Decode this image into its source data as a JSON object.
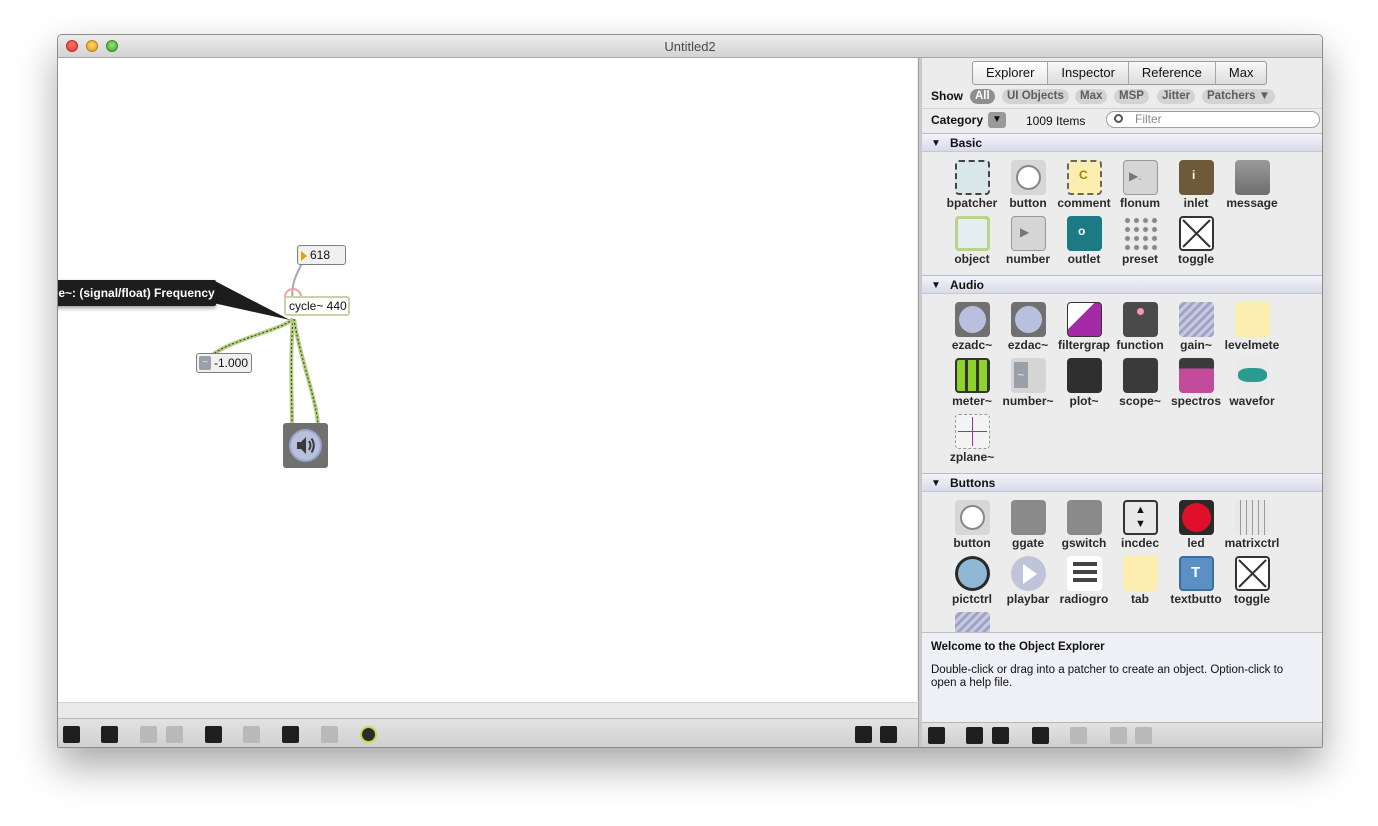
{
  "window": {
    "title": "Untitled2"
  },
  "patcher": {
    "tooltip": "cycle~: (signal/float) Frequency",
    "number_box": "618",
    "cycle_object": "cycle~ 440",
    "signal_number": "-1.000"
  },
  "explorer": {
    "tabs": [
      "Explorer",
      "Inspector",
      "Reference",
      "Max"
    ],
    "show_label": "Show",
    "filters": [
      "All",
      "UI Objects",
      "Max",
      "MSP",
      "Jitter",
      "Patchers ▼"
    ],
    "category_label": "Category",
    "category_arrow": "▼",
    "item_count": "1009 Items",
    "filter_placeholder": "Filter",
    "sections": [
      {
        "title": "Basic",
        "items": [
          "bpatcher",
          "button",
          "comment",
          "flonum",
          "inlet",
          "message",
          "object",
          "number",
          "outlet",
          "preset",
          "toggle"
        ]
      },
      {
        "title": "Audio",
        "items": [
          "ezadc~",
          "ezdac~",
          "filtergrap",
          "function",
          "gain~",
          "levelmete",
          "meter~",
          "number~",
          "plot~",
          "scope~",
          "spectros",
          "wavefor",
          "zplane~"
        ]
      },
      {
        "title": "Buttons",
        "items": [
          "button",
          "ggate",
          "gswitch",
          "incdec",
          "led",
          "matrixctrl",
          "pictctrl",
          "playbar",
          "radiogro",
          "tab",
          "textbutto",
          "toggle"
        ]
      }
    ],
    "info": {
      "title": "Welcome to the Object Explorer",
      "body": "Double-click or drag into a patcher to create an object. Option-click to open a help file."
    }
  },
  "colors": {
    "patch_cord": "#b5cf7f",
    "tooltip_bg": "#1d1d1d",
    "active_pill": "#8e8e8e",
    "led_red": "#e0102b",
    "outlet_teal": "#1b7a83",
    "inlet_brown": "#6e5a3a",
    "comment_yellow": "#fbeeb0",
    "meter_green": "#8fd12d"
  }
}
